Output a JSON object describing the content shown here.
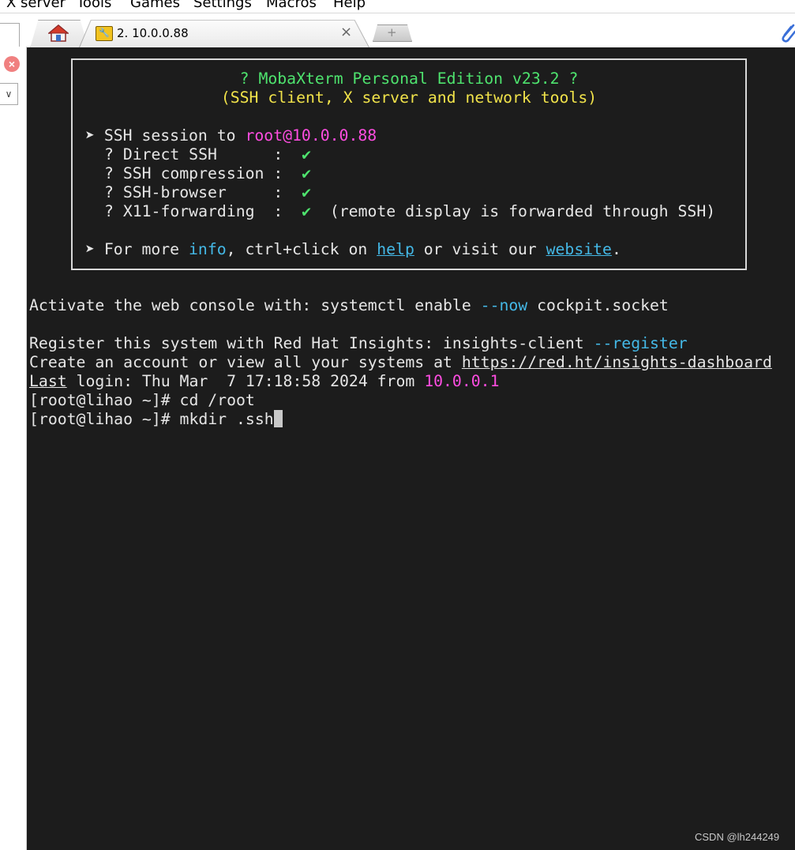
{
  "menu": {
    "items": [
      "X server",
      "Tools",
      "Games",
      "Settings",
      "Macros",
      "Help"
    ]
  },
  "tabs": {
    "session_label": "2. 10.0.0.88",
    "close_glyph": "×",
    "new_tab_glyph": "+"
  },
  "icons": {
    "home": "home-icon",
    "session": "key-icon",
    "attach": "paperclip-icon",
    "side_close": "close-circle-icon",
    "side_dropdown": "chevron-down-icon"
  },
  "banner": {
    "title": "? MobaXterm Personal Edition v23.2 ?",
    "subtitle": "(SSH client, X server and network tools)",
    "session_prefix": "➤ SSH session to ",
    "session_host": "root@10.0.0.88",
    "features": [
      {
        "label": "? Direct SSH      :  ",
        "check": "✔",
        "note": ""
      },
      {
        "label": "? SSH compression :  ",
        "check": "✔",
        "note": ""
      },
      {
        "label": "? SSH-browser     :  ",
        "check": "✔",
        "note": ""
      },
      {
        "label": "? X11-forwarding  :  ",
        "check": "✔",
        "note": "  (remote display is forwarded through SSH)"
      }
    ],
    "more_prefix": "➤ For more ",
    "more_info": "info",
    "more_mid": ", ctrl+click on ",
    "more_help": "help",
    "more_mid2": " or visit our ",
    "more_website": "website",
    "more_suffix": "."
  },
  "terminal": {
    "cockpit_prefix": "Activate the web console with: systemctl enable ",
    "cockpit_flag": "--now",
    "cockpit_suffix": " cockpit.socket",
    "insights_prefix": "Register this system with Red Hat Insights: insights-client ",
    "insights_flag": "--register",
    "account_prefix": "Create an account or view all your systems at ",
    "account_url": "https://red.ht/insights-dashboard",
    "last_word": "Last",
    "last_rest": " login: Thu Mar  7 17:18:58 2024 from ",
    "last_ip": "10.0.0.1",
    "prompt1": "[root@lihao ~]# cd /root",
    "prompt2": "[root@lihao ~]# mkdir .ssh"
  },
  "watermark": "CSDN @lh244249"
}
